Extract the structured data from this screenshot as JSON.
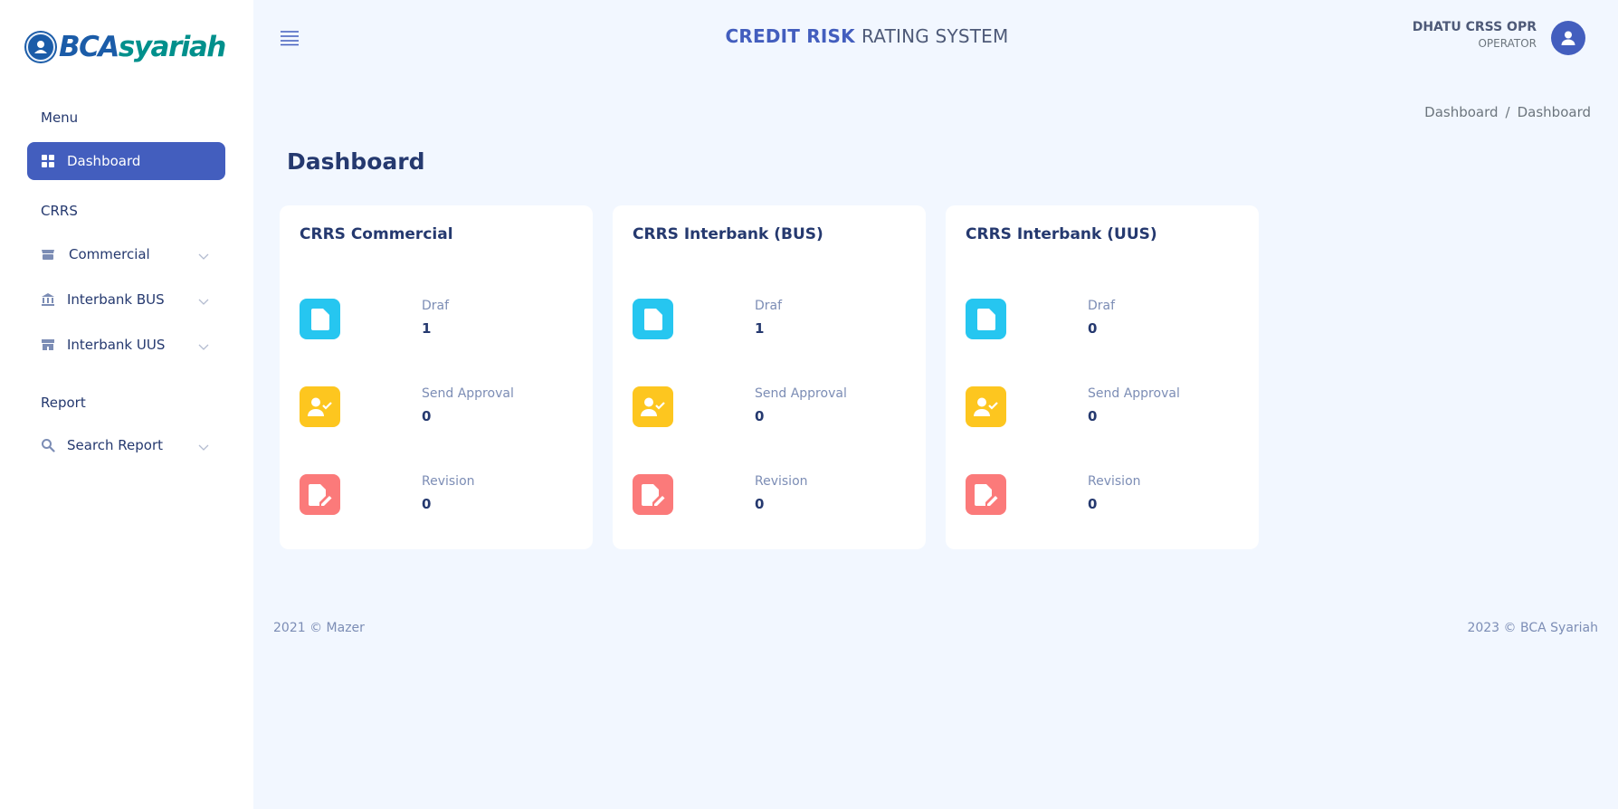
{
  "brand": {
    "part1": "BCA",
    "part2": "syariah"
  },
  "sidebar": {
    "sections": [
      {
        "title": "Menu"
      },
      {
        "title": "CRRS"
      },
      {
        "title": "Report"
      }
    ],
    "items": [
      {
        "label": "Dashboard",
        "icon": "grid-icon",
        "active": true
      },
      {
        "label": "Commercial",
        "icon": "store-icon"
      },
      {
        "label": "Interbank BUS",
        "icon": "bank-icon"
      },
      {
        "label": "Interbank UUS",
        "icon": "shop-icon"
      },
      {
        "label": "Search Report",
        "icon": "search-icon"
      }
    ]
  },
  "header": {
    "title_part1": "CREDIT RISK",
    "title_part2": "RATING SYSTEM",
    "user_name": "DHATU CRSS OPR",
    "user_role": "OPERATOR"
  },
  "breadcrumb": {
    "items": [
      "Dashboard",
      "Dashboard"
    ],
    "separator": "/"
  },
  "page": {
    "title": "Dashboard"
  },
  "cards": [
    {
      "title": "CRRS Commercial",
      "stats": [
        {
          "label": "Draf",
          "value": "1"
        },
        {
          "label": "Send Approval",
          "value": "0"
        },
        {
          "label": "Revision",
          "value": "0"
        }
      ]
    },
    {
      "title": "CRRS Interbank (BUS)",
      "stats": [
        {
          "label": "Draf",
          "value": "1"
        },
        {
          "label": "Send Approval",
          "value": "0"
        },
        {
          "label": "Revision",
          "value": "0"
        }
      ]
    },
    {
      "title": "CRRS Interbank (UUS)",
      "stats": [
        {
          "label": "Draf",
          "value": "0"
        },
        {
          "label": "Send Approval",
          "value": "0"
        },
        {
          "label": "Revision",
          "value": "0"
        }
      ]
    }
  ],
  "footer": {
    "left": "2021 © Mazer",
    "right": "2023 © BCA Syariah"
  },
  "colors": {
    "primary": "#435ebe",
    "draf_icon": "#26c6f0",
    "approval_icon": "#fdc61f",
    "revision_icon": "#fb7a7a"
  }
}
